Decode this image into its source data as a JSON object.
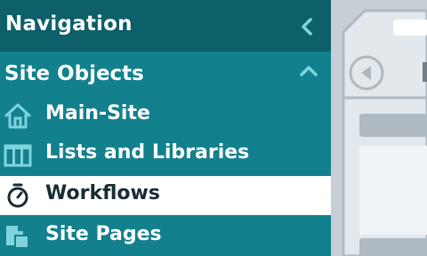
{
  "navigation": {
    "title": "Navigation",
    "collapse_icon": "chevron-left-icon"
  },
  "site_objects": {
    "title": "Site Objects",
    "toggle_icon": "chevron-up-icon",
    "items": [
      {
        "label": "Main-Site",
        "icon": "home-icon",
        "active": false
      },
      {
        "label": "Lists and Libraries",
        "icon": "columns-icon",
        "active": false
      },
      {
        "label": "Workflows",
        "icon": "stopwatch-icon",
        "active": true
      },
      {
        "label": "Site Pages",
        "icon": "pages-icon",
        "active": false
      }
    ]
  },
  "colors": {
    "header_bg": "#0d5f6a",
    "sidebar_bg": "#12808d",
    "accent_icon": "#7fd3dd",
    "active_bg": "#ffffff",
    "preview_bg": "#c8d1d8"
  }
}
